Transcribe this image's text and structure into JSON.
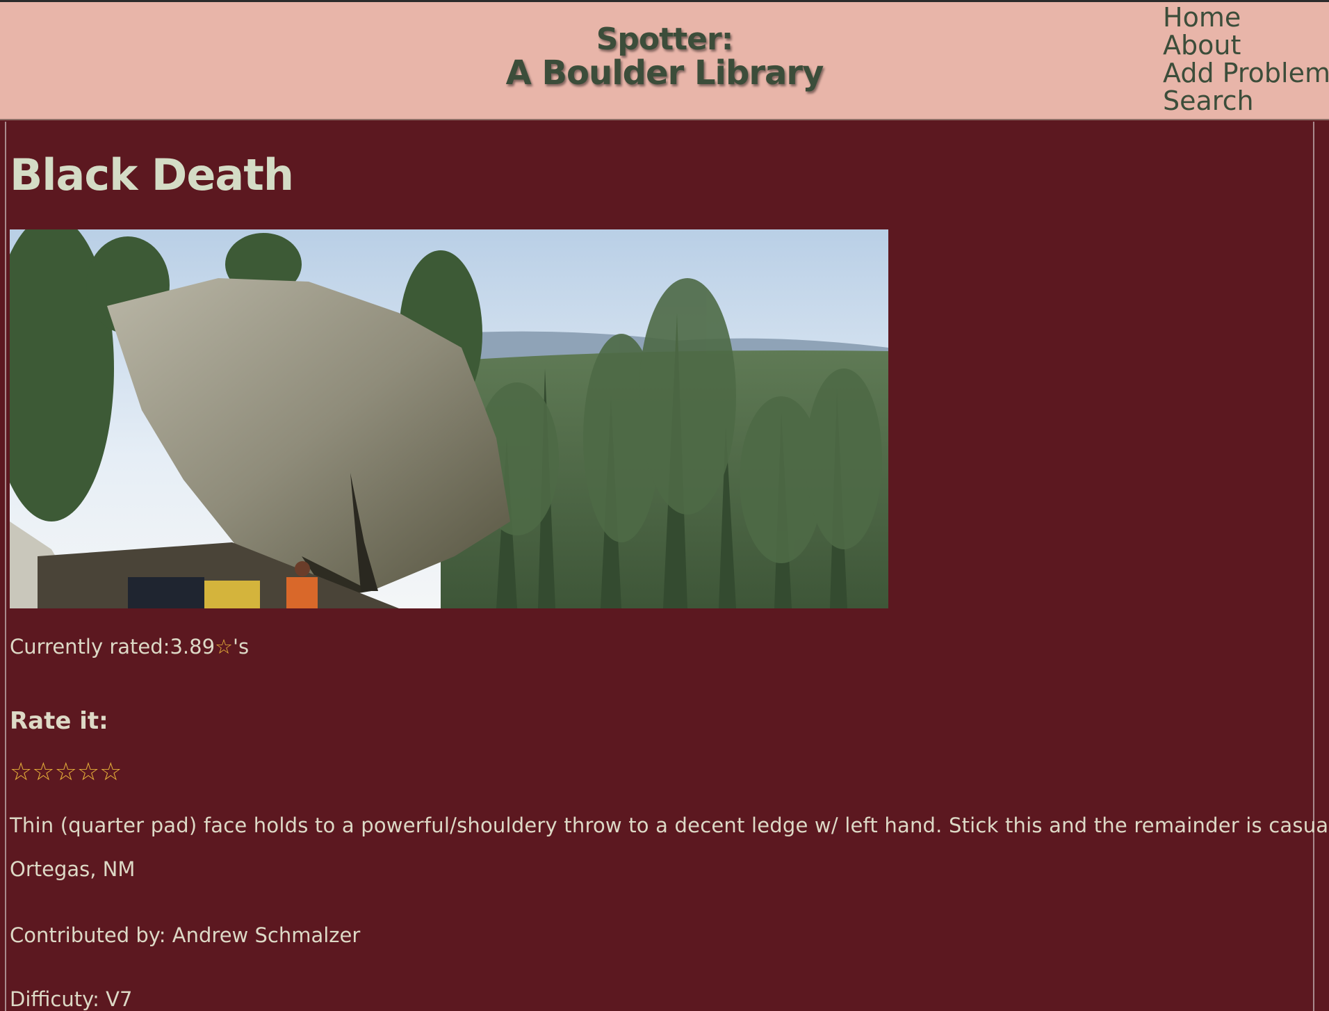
{
  "header": {
    "title_line1": "Spotter:",
    "title_line2": "A Boulder Library",
    "nav": [
      "Home",
      "About",
      "Add Problem",
      "Search"
    ]
  },
  "problem": {
    "name": "Black Death",
    "rating_prefix": "Currently rated:",
    "rating_value": "3.89",
    "rating_star": "☆",
    "rating_suffix": "'s",
    "rate_heading": "Rate it:",
    "rate_stars": [
      "☆",
      "☆",
      "☆",
      "☆",
      "☆"
    ],
    "description": "Thin (quarter pad) face holds to a powerful/shouldery throw to a decent ledge w/ left hand. Stick this and the remainder is casual",
    "location": "Ortegas, NM",
    "contributed_by": "Contributed by: Andrew Schmalzer",
    "difficulty": "Difficuty: V7"
  },
  "colors": {
    "header_bg": "#e8b5a9",
    "page_bg": "#5c1820",
    "title_text": "#3c4d3a",
    "body_text": "#ddd9c6",
    "heading_text": "#d4dcc6",
    "star": "#e8b23a"
  }
}
